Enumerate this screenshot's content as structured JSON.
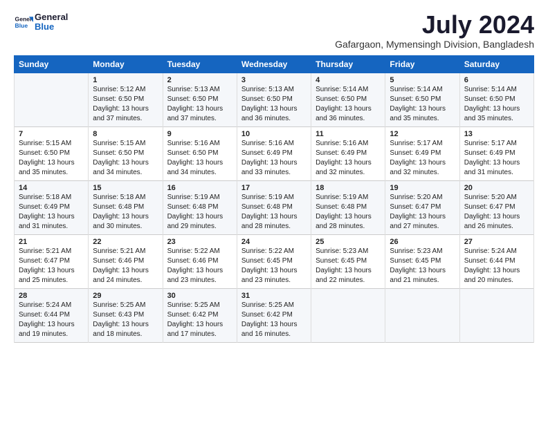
{
  "header": {
    "logo_line1": "General",
    "logo_line2": "Blue",
    "title": "July 2024",
    "subtitle": "Gafargaon, Mymensingh Division, Bangladesh"
  },
  "days": [
    "Sunday",
    "Monday",
    "Tuesday",
    "Wednesday",
    "Thursday",
    "Friday",
    "Saturday"
  ],
  "weeks": [
    [
      {
        "day": "",
        "data": ""
      },
      {
        "day": "1",
        "data": "Sunrise: 5:12 AM\nSunset: 6:50 PM\nDaylight: 13 hours\nand 37 minutes."
      },
      {
        "day": "2",
        "data": "Sunrise: 5:13 AM\nSunset: 6:50 PM\nDaylight: 13 hours\nand 37 minutes."
      },
      {
        "day": "3",
        "data": "Sunrise: 5:13 AM\nSunset: 6:50 PM\nDaylight: 13 hours\nand 36 minutes."
      },
      {
        "day": "4",
        "data": "Sunrise: 5:14 AM\nSunset: 6:50 PM\nDaylight: 13 hours\nand 36 minutes."
      },
      {
        "day": "5",
        "data": "Sunrise: 5:14 AM\nSunset: 6:50 PM\nDaylight: 13 hours\nand 35 minutes."
      },
      {
        "day": "6",
        "data": "Sunrise: 5:14 AM\nSunset: 6:50 PM\nDaylight: 13 hours\nand 35 minutes."
      }
    ],
    [
      {
        "day": "7",
        "data": "Sunrise: 5:15 AM\nSunset: 6:50 PM\nDaylight: 13 hours\nand 35 minutes."
      },
      {
        "day": "8",
        "data": "Sunrise: 5:15 AM\nSunset: 6:50 PM\nDaylight: 13 hours\nand 34 minutes."
      },
      {
        "day": "9",
        "data": "Sunrise: 5:16 AM\nSunset: 6:50 PM\nDaylight: 13 hours\nand 34 minutes."
      },
      {
        "day": "10",
        "data": "Sunrise: 5:16 AM\nSunset: 6:49 PM\nDaylight: 13 hours\nand 33 minutes."
      },
      {
        "day": "11",
        "data": "Sunrise: 5:16 AM\nSunset: 6:49 PM\nDaylight: 13 hours\nand 32 minutes."
      },
      {
        "day": "12",
        "data": "Sunrise: 5:17 AM\nSunset: 6:49 PM\nDaylight: 13 hours\nand 32 minutes."
      },
      {
        "day": "13",
        "data": "Sunrise: 5:17 AM\nSunset: 6:49 PM\nDaylight: 13 hours\nand 31 minutes."
      }
    ],
    [
      {
        "day": "14",
        "data": "Sunrise: 5:18 AM\nSunset: 6:49 PM\nDaylight: 13 hours\nand 31 minutes."
      },
      {
        "day": "15",
        "data": "Sunrise: 5:18 AM\nSunset: 6:48 PM\nDaylight: 13 hours\nand 30 minutes."
      },
      {
        "day": "16",
        "data": "Sunrise: 5:19 AM\nSunset: 6:48 PM\nDaylight: 13 hours\nand 29 minutes."
      },
      {
        "day": "17",
        "data": "Sunrise: 5:19 AM\nSunset: 6:48 PM\nDaylight: 13 hours\nand 28 minutes."
      },
      {
        "day": "18",
        "data": "Sunrise: 5:19 AM\nSunset: 6:48 PM\nDaylight: 13 hours\nand 28 minutes."
      },
      {
        "day": "19",
        "data": "Sunrise: 5:20 AM\nSunset: 6:47 PM\nDaylight: 13 hours\nand 27 minutes."
      },
      {
        "day": "20",
        "data": "Sunrise: 5:20 AM\nSunset: 6:47 PM\nDaylight: 13 hours\nand 26 minutes."
      }
    ],
    [
      {
        "day": "21",
        "data": "Sunrise: 5:21 AM\nSunset: 6:47 PM\nDaylight: 13 hours\nand 25 minutes."
      },
      {
        "day": "22",
        "data": "Sunrise: 5:21 AM\nSunset: 6:46 PM\nDaylight: 13 hours\nand 24 minutes."
      },
      {
        "day": "23",
        "data": "Sunrise: 5:22 AM\nSunset: 6:46 PM\nDaylight: 13 hours\nand 23 minutes."
      },
      {
        "day": "24",
        "data": "Sunrise: 5:22 AM\nSunset: 6:45 PM\nDaylight: 13 hours\nand 23 minutes."
      },
      {
        "day": "25",
        "data": "Sunrise: 5:23 AM\nSunset: 6:45 PM\nDaylight: 13 hours\nand 22 minutes."
      },
      {
        "day": "26",
        "data": "Sunrise: 5:23 AM\nSunset: 6:45 PM\nDaylight: 13 hours\nand 21 minutes."
      },
      {
        "day": "27",
        "data": "Sunrise: 5:24 AM\nSunset: 6:44 PM\nDaylight: 13 hours\nand 20 minutes."
      }
    ],
    [
      {
        "day": "28",
        "data": "Sunrise: 5:24 AM\nSunset: 6:44 PM\nDaylight: 13 hours\nand 19 minutes."
      },
      {
        "day": "29",
        "data": "Sunrise: 5:25 AM\nSunset: 6:43 PM\nDaylight: 13 hours\nand 18 minutes."
      },
      {
        "day": "30",
        "data": "Sunrise: 5:25 AM\nSunset: 6:42 PM\nDaylight: 13 hours\nand 17 minutes."
      },
      {
        "day": "31",
        "data": "Sunrise: 5:25 AM\nSunset: 6:42 PM\nDaylight: 13 hours\nand 16 minutes."
      },
      {
        "day": "",
        "data": ""
      },
      {
        "day": "",
        "data": ""
      },
      {
        "day": "",
        "data": ""
      }
    ]
  ]
}
